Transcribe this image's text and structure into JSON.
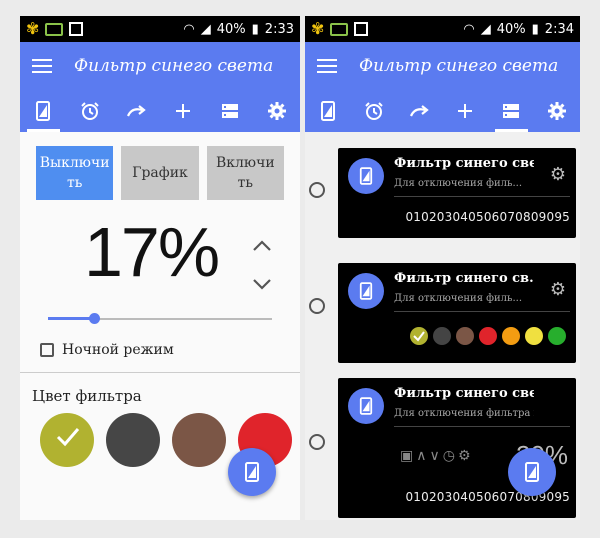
{
  "left": {
    "status": {
      "battery": "40%",
      "time": "2:33"
    },
    "app_title": "Фильтр синего света",
    "tabs": [
      "phone-filter-icon",
      "alarm-icon",
      "redo-icon",
      "plus-icon",
      "list-icon",
      "gear-icon"
    ],
    "mode_buttons": {
      "off": "Выключи ть",
      "schedule": "График",
      "on": "Включи ть"
    },
    "percent": "17%",
    "slider_value": 0.17,
    "night_mode_label": "Ночной режим",
    "filter_color_title": "Цвет фильтра",
    "swatch_colors": [
      "#b1b230",
      "#464646",
      "#7b5646",
      "#e0242b"
    ]
  },
  "right": {
    "status": {
      "battery": "40%",
      "time": "2:34"
    },
    "app_title": "Фильтр синего света",
    "cards": [
      {
        "title": "Фильтр синего све...",
        "subtitle": "Для отключения филь...",
        "hours": "010203040506070809095"
      },
      {
        "title": "Фильтр синего св...",
        "subtitle": "Для отключения филь...",
        "swatches": [
          "#b1b230",
          "#444444",
          "#7b5646",
          "#e0242b",
          "#f39c12",
          "#f0e040",
          "#27ae2d"
        ]
      },
      {
        "title": "Фильтр синего света",
        "subtitle": "Для отключения фильтра на...",
        "percent": "20%",
        "hours": "010203040506070809095"
      }
    ]
  }
}
